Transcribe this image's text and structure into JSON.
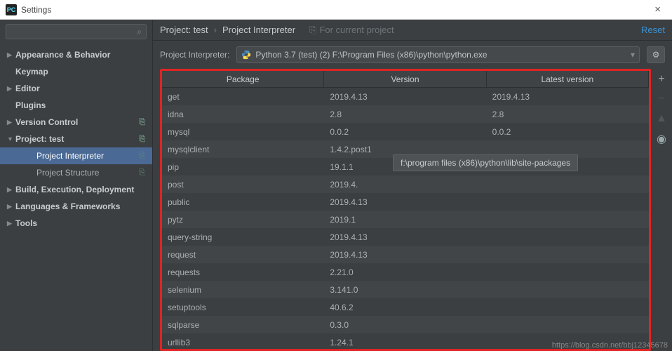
{
  "window": {
    "title": "Settings",
    "close_glyph": "×"
  },
  "search": {
    "placeholder": "",
    "icon": "⌕"
  },
  "sidebar": {
    "items": [
      {
        "label": "Appearance & Behavior",
        "arrow": "▶",
        "bold": true
      },
      {
        "label": "Keymap",
        "arrow": "",
        "bold": true
      },
      {
        "label": "Editor",
        "arrow": "▶",
        "bold": true
      },
      {
        "label": "Plugins",
        "arrow": "",
        "bold": true
      },
      {
        "label": "Version Control",
        "arrow": "▶",
        "bold": true,
        "copy": "⎘"
      },
      {
        "label": "Project: test",
        "arrow": "▼",
        "bold": true,
        "copy": "⎘"
      },
      {
        "label": "Project Interpreter",
        "sub": true,
        "selected": true,
        "copy": "⎘"
      },
      {
        "label": "Project Structure",
        "sub": true,
        "copy": "⎘"
      },
      {
        "label": "Build, Execution, Deployment",
        "arrow": "▶",
        "bold": true
      },
      {
        "label": "Languages & Frameworks",
        "arrow": "▶",
        "bold": true
      },
      {
        "label": "Tools",
        "arrow": "▶",
        "bold": true
      }
    ]
  },
  "breadcrumb": {
    "project": "Project: test",
    "page": "Project Interpreter",
    "hint": "For current project",
    "reset": "Reset"
  },
  "interpreter": {
    "label": "Project Interpreter:",
    "value": "Python 3.7 (test) (2) F:\\Program Files (x86)\\python\\python.exe",
    "gear": "⚙"
  },
  "table": {
    "headers": [
      "Package",
      "Version",
      "Latest version"
    ],
    "rows": [
      {
        "pkg": "get",
        "ver": "2019.4.13",
        "latest": "2019.4.13"
      },
      {
        "pkg": "idna",
        "ver": "2.8",
        "latest": "2.8"
      },
      {
        "pkg": "mysql",
        "ver": "0.0.2",
        "latest": "0.0.2"
      },
      {
        "pkg": "mysqlclient",
        "ver": "1.4.2.post1",
        "latest": ""
      },
      {
        "pkg": "pip",
        "ver": "19.1.1",
        "latest": ""
      },
      {
        "pkg": "post",
        "ver": "2019.4.",
        "latest": ""
      },
      {
        "pkg": "public",
        "ver": "2019.4.13",
        "latest": ""
      },
      {
        "pkg": "pytz",
        "ver": "2019.1",
        "latest": ""
      },
      {
        "pkg": "query-string",
        "ver": "2019.4.13",
        "latest": ""
      },
      {
        "pkg": "request",
        "ver": "2019.4.13",
        "latest": ""
      },
      {
        "pkg": "requests",
        "ver": "2.21.0",
        "latest": ""
      },
      {
        "pkg": "selenium",
        "ver": "3.141.0",
        "latest": ""
      },
      {
        "pkg": "setuptools",
        "ver": "40.6.2",
        "latest": ""
      },
      {
        "pkg": "sqlparse",
        "ver": "0.3.0",
        "latest": ""
      },
      {
        "pkg": "urllib3",
        "ver": "1.24.1",
        "latest": ""
      }
    ]
  },
  "actions": {
    "add": "+",
    "remove": "−",
    "up": "▲",
    "eye": "◉"
  },
  "tooltip": "f:\\program files (x86)\\python\\lib\\site-packages",
  "watermark": "https://blog.csdn.net/bbj12345678"
}
